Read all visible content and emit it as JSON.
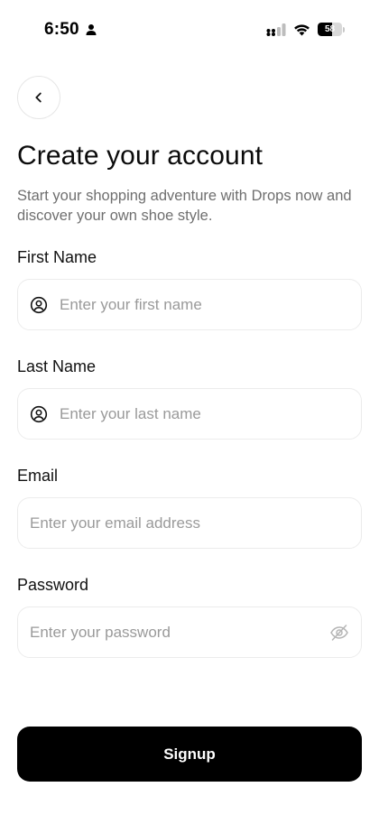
{
  "status_bar": {
    "time": "6:50",
    "battery_level": "58",
    "battery_fraction": 0.58
  },
  "header": {
    "back_icon": "chevron-left-icon",
    "title": "Create your account",
    "subtitle": "Start your shopping adventure with Drops now and discover your own shoe style."
  },
  "form": {
    "first_name": {
      "label": "First Name",
      "placeholder": "Enter your first name",
      "value": "",
      "icon": "user-circle-icon"
    },
    "last_name": {
      "label": "Last Name",
      "placeholder": "Enter your last name",
      "value": "",
      "icon": "user-circle-icon"
    },
    "email": {
      "label": "Email",
      "placeholder": "Enter your email address",
      "value": ""
    },
    "password": {
      "label": "Password",
      "placeholder": "Enter your password",
      "value": "",
      "toggle_icon": "eye-off-icon"
    }
  },
  "actions": {
    "signup_label": "Signup"
  },
  "colors": {
    "primary_button": "#000000",
    "field_border": "#ececec",
    "placeholder": "#9a9a9a",
    "subtitle": "#6f6f6f"
  }
}
